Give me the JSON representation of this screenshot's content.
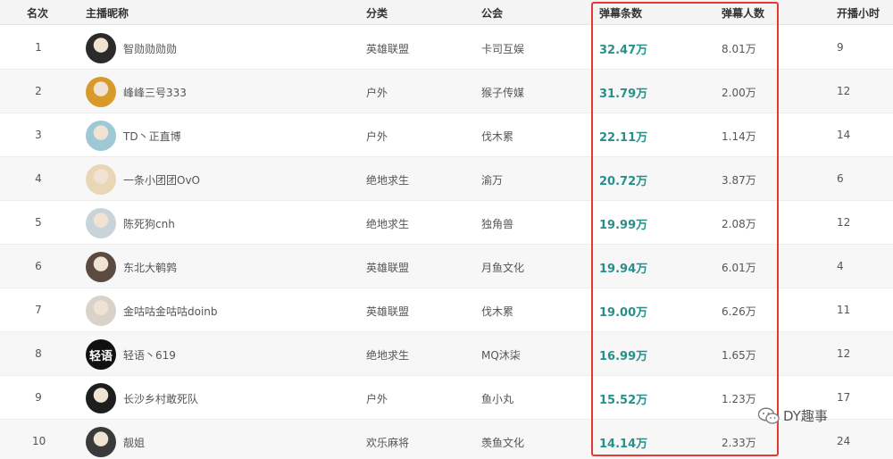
{
  "header": {
    "rank": "名次",
    "name": "主播昵称",
    "category": "分类",
    "guild": "公会",
    "danmaku_count": "弹幕条数",
    "danmaku_people": "弹幕人数",
    "hours": "开播小时"
  },
  "rows": [
    {
      "rank": "1",
      "name": "智勋勋勋勋",
      "category": "英雄联盟",
      "guild": "卡司互娱",
      "count": "32.47万",
      "people": "8.01万",
      "hours": "9",
      "avatar_color": "#2b2b2b"
    },
    {
      "rank": "2",
      "name": "峰峰三号333",
      "category": "户外",
      "guild": "猴子传媒",
      "count": "31.79万",
      "people": "2.00万",
      "hours": "12",
      "avatar_color": "#d89a2a"
    },
    {
      "rank": "3",
      "name": "TD丶正直博",
      "category": "户外",
      "guild": "伐木累",
      "count": "22.11万",
      "people": "1.14万",
      "hours": "14",
      "avatar_color": "#9fc8d6"
    },
    {
      "rank": "4",
      "name": "一条小团团OvO",
      "category": "绝地求生",
      "guild": "渝万",
      "count": "20.72万",
      "people": "3.87万",
      "hours": "6",
      "avatar_color": "#e9d6b5"
    },
    {
      "rank": "5",
      "name": "陈死狗cnh",
      "category": "绝地求生",
      "guild": "独角兽",
      "count": "19.99万",
      "people": "2.08万",
      "hours": "12",
      "avatar_color": "#c9d4d8"
    },
    {
      "rank": "6",
      "name": "东北大鹌鹑",
      "category": "英雄联盟",
      "guild": "月鱼文化",
      "count": "19.94万",
      "people": "6.01万",
      "hours": "4",
      "avatar_color": "#5a4a40"
    },
    {
      "rank": "7",
      "name": "金咕咕金咕咕doinb",
      "category": "英雄联盟",
      "guild": "伐木累",
      "count": "19.00万",
      "people": "6.26万",
      "hours": "11",
      "avatar_color": "#d8d2c8"
    },
    {
      "rank": "8",
      "name": "轻语丶619",
      "category": "绝地求生",
      "guild": "MQ沐柒",
      "count": "16.99万",
      "people": "1.65万",
      "hours": "12",
      "avatar_color": "#111111",
      "avatar_text": "轻语"
    },
    {
      "rank": "9",
      "name": "长沙乡村敢死队",
      "category": "户外",
      "guild": "鱼小丸",
      "count": "15.52万",
      "people": "1.23万",
      "hours": "17",
      "avatar_color": "#1e1e1e"
    },
    {
      "rank": "10",
      "name": "靓姐",
      "category": "欢乐麻将",
      "guild": "羡鱼文化",
      "count": "14.14万",
      "people": "2.33万",
      "hours": "24",
      "avatar_color": "#3a3a3a"
    }
  ],
  "watermark": {
    "text": "DY趣事",
    "icon": "wechat-icon"
  },
  "colors": {
    "accent": "#2a8f8b",
    "highlight": "#e53935"
  }
}
